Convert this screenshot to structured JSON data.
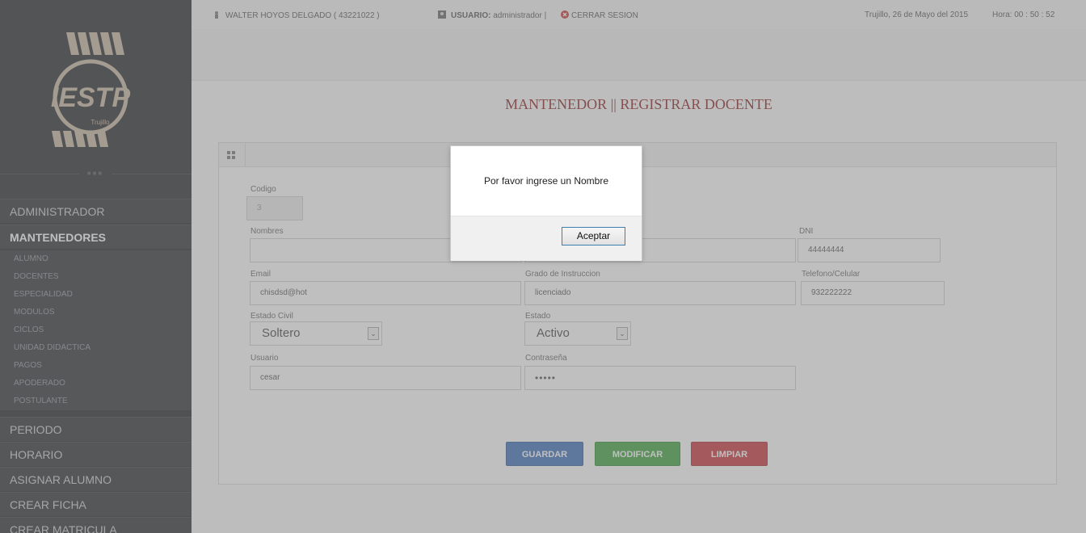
{
  "topbar": {
    "user_info": "WALTER HOYOS DELGADO ( 43221022 )",
    "usuario_label": "USUARIO:",
    "usuario_value": "administrador |",
    "logout": "CERRAR SESION",
    "date": "Trujillo, 26 de Mayo del 2015",
    "time": "Hora: 00 : 50 : 52"
  },
  "logo": {
    "text": "IESTP",
    "city": "Trujillo"
  },
  "sidebar": {
    "administrador": "ADMINISTRADOR",
    "mantenedores": "MANTENEDORES",
    "sub_items": [
      "ALUMNO",
      "DOCENTES",
      "ESPECIALIDAD",
      "MODULOS",
      "CICLOS",
      "UNIDAD DIDACTICA",
      "PAGOS",
      "APODERADO",
      "POSTULANTE"
    ],
    "periodo": "PERIODO",
    "horario": "HORARIO",
    "asignar_alumno": "ASIGNAR ALUMNO",
    "crear_ficha": "CREAR FICHA",
    "crear_matricula": "CREAR MATRICULA"
  },
  "page": {
    "title": "MANTENEDOR || REGISTRAR DOCENTE"
  },
  "form": {
    "codigo_label": "Codigo",
    "codigo_value": "3",
    "nombres_label": "Nombres",
    "nombres_value": "",
    "dni_label": "DNI",
    "dni_value": "44444444",
    "email_label": "Email",
    "email_value": "chisdsd@hot",
    "grado_label": "Grado de Instruccion",
    "grado_value": "licenciado",
    "telefono_label": "Telefono/Celular",
    "telefono_value": "932222222",
    "estado_civil_label": "Estado Civil",
    "estado_civil_value": "Soltero",
    "estado_label": "Estado",
    "estado_value": "Activo",
    "usuario_label": "Usuario",
    "usuario_value": "cesar",
    "password_label": "Contraseña",
    "password_value": "•••••"
  },
  "buttons": {
    "guardar": "GUARDAR",
    "modificar": "MODIFICAR",
    "limpiar": "LIMPIAR"
  },
  "dialog": {
    "message": "Por favor ingrese un Nombre",
    "ok": "Aceptar"
  },
  "colors": {
    "title": "#8b1c1c",
    "btn_blue": "#3c6fb8",
    "btn_green": "#3fa33f",
    "btn_red": "#c9333a"
  }
}
